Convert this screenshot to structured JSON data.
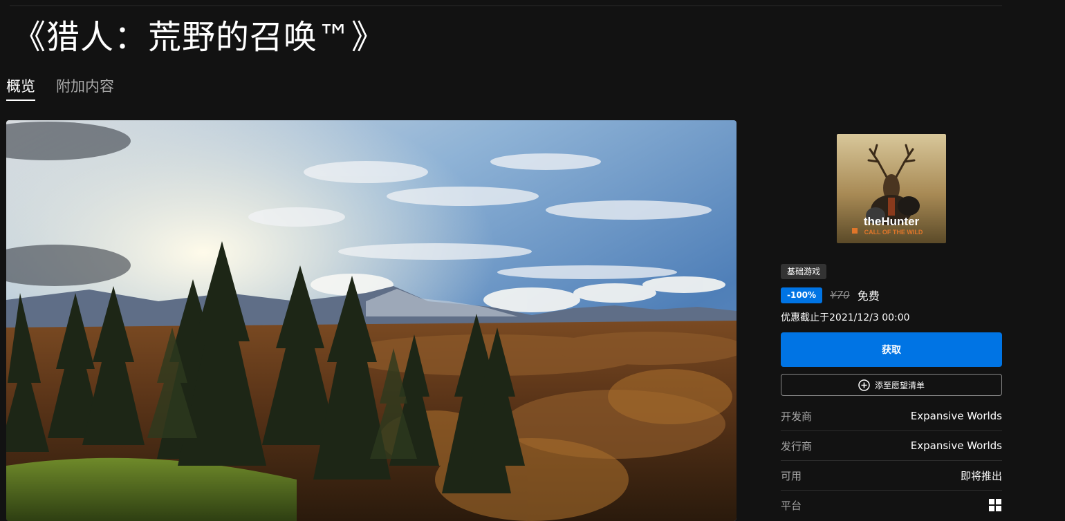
{
  "title": "《猎人：荒野的召唤™》",
  "tabs": [
    {
      "label": "概览",
      "active": true
    },
    {
      "label": "附加内容",
      "active": false
    }
  ],
  "cover": {
    "line1": "theHunter",
    "line2": "CALL OF THE WILD"
  },
  "sidebar": {
    "base_badge": "基础游戏",
    "discount": "-100%",
    "original_price": "¥70",
    "final_price": "免费",
    "sale_end": "优惠截止于2021/12/3 00:00",
    "get_label": "获取",
    "wishlist_label": "添至愿望清单",
    "details": [
      {
        "label": "开发商",
        "value": "Expansive Worlds"
      },
      {
        "label": "发行商",
        "value": "Expansive Worlds"
      },
      {
        "label": "可用",
        "value": "即将推出"
      },
      {
        "label": "平台",
        "value": "",
        "icon": "windows-icon"
      }
    ]
  },
  "colors": {
    "background": "#121212",
    "accent": "#0074e4",
    "muted_text": "#a8a8a8",
    "badge": "#333333"
  }
}
